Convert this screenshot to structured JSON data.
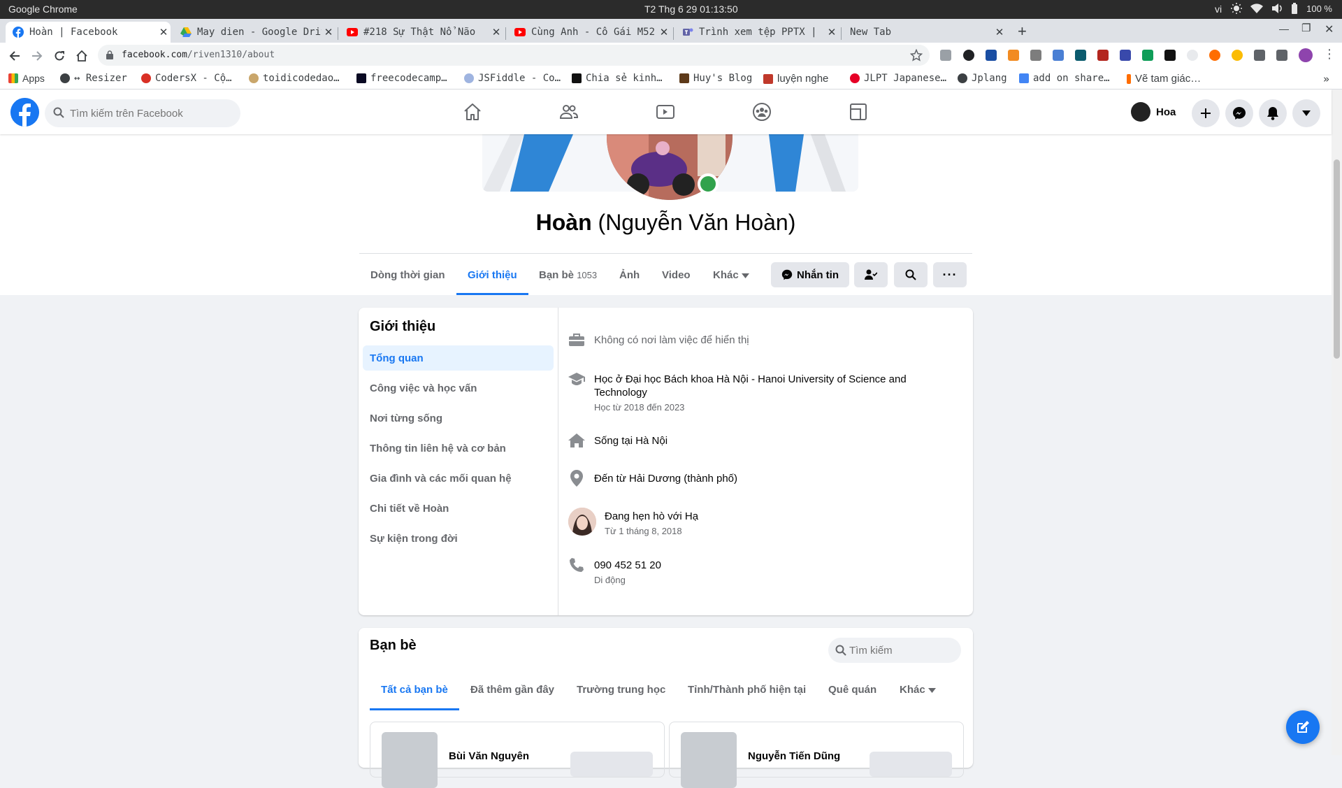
{
  "os": {
    "app_name": "Google Chrome",
    "clock": "T2 Thg 6 29  01:13:50",
    "lang": "vi",
    "battery": "100 %"
  },
  "tabs": [
    {
      "title": "Hoàn | Facebook",
      "favicon": "facebook-icon"
    },
    {
      "title": "May dien - Google Drive",
      "favicon": "google-drive-icon"
    },
    {
      "title": "#218 Sự Thật Nổ Não",
      "favicon": "youtube-icon"
    },
    {
      "title": "Cùng Anh - Cô Gái M52",
      "favicon": "youtube-icon"
    },
    {
      "title": "Trình xem tệp PPTX | ",
      "favicon": "teams-icon"
    },
    {
      "title": "New Tab",
      "favicon": ""
    }
  ],
  "address": {
    "domain": "facebook.com",
    "path": "/riven1310/about"
  },
  "bookmarks": [
    "Apps",
    "↔ Resizer",
    "CodersX - Cộ…",
    "toidicodedao…",
    "freecodecamp…",
    "JSFiddle - Co…",
    "Chia sẻ kinh…",
    "Huy's Blog",
    "luyện nghe",
    "JLPT Japanese…",
    "Jplang",
    "add on share…",
    "Vẽ tam giác…"
  ],
  "fb": {
    "search_placeholder": "Tìm kiếm trên Facebook",
    "user_name": "Hoa",
    "brand_color": "#1877f2"
  },
  "profile": {
    "name": "Hoàn",
    "alt_name": "(Nguyễn Văn Hoàn)",
    "tabs": [
      {
        "label": "Dòng thời gian"
      },
      {
        "label": "Giới thiệu"
      },
      {
        "label": "Bạn bè",
        "count": "1053"
      },
      {
        "label": "Ảnh"
      },
      {
        "label": "Video"
      },
      {
        "label": "Khác"
      }
    ],
    "message_button": "Nhắn tin"
  },
  "about": {
    "title": "Giới thiệu",
    "menu": [
      "Tổng quan",
      "Công việc và học vấn",
      "Nơi từng sống",
      "Thông tin liên hệ và cơ bản",
      "Gia đình và các mối quan hệ",
      "Chi tiết về Hoàn",
      "Sự kiện trong đời"
    ],
    "work": "Không có nơi làm việc để hiển thị",
    "education": "Học ở Đại học Bách khoa Hà Nội - Hanoi University of Science and Technology",
    "education_sub": "Học từ 2018 đến 2023",
    "lives": "Sống tại Hà Nội",
    "from": "Đến từ Hải Dương (thành phố)",
    "relationship": "Đang hẹn hò với Hạ",
    "relationship_sub": "Từ 1 tháng 8, 2018",
    "phone": "090 452 51 20",
    "phone_sub": "Di động"
  },
  "friends": {
    "title": "Bạn bè",
    "search_placeholder": "Tìm kiếm",
    "tabs": [
      "Tất cả bạn bè",
      "Đã thêm gần đây",
      "Trường trung học",
      "Tỉnh/Thành phố hiện tại",
      "Quê quán",
      "Khác"
    ],
    "cards": [
      "Bùi Văn Nguyên",
      "Nguyễn Tiến Dũng"
    ]
  }
}
